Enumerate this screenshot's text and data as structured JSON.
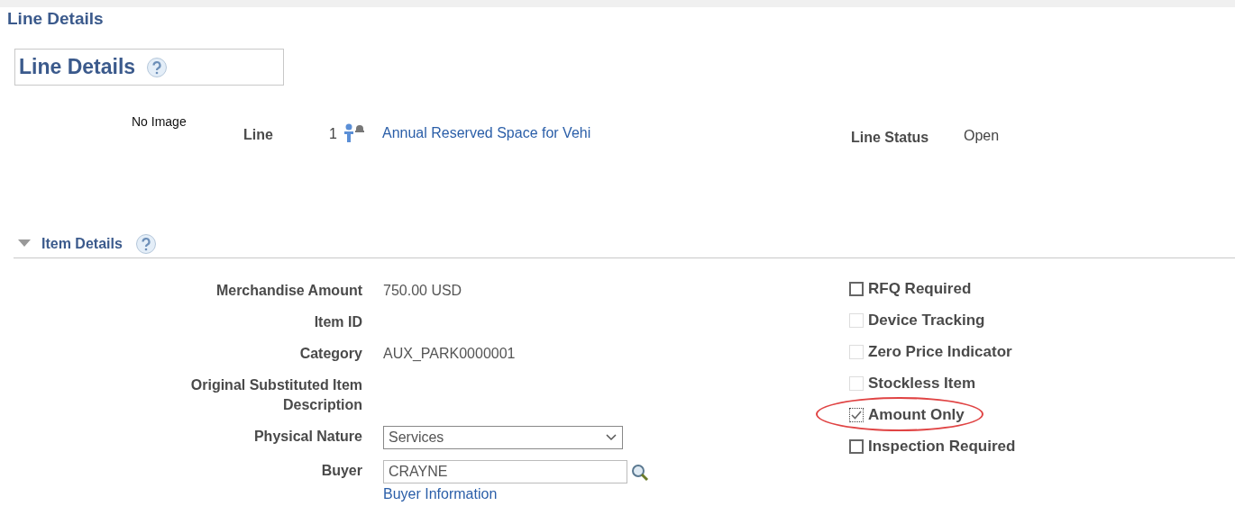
{
  "page_title": "Line Details",
  "panel": {
    "title": "Line Details"
  },
  "line": {
    "image_text": "No Image",
    "label": "Line",
    "number": "1",
    "description": "Annual Reserved Space for Vehi",
    "status_label": "Line Status",
    "status": "Open"
  },
  "section": {
    "title": "Item Details",
    "expanded": true
  },
  "fields": [
    {
      "kind": "text",
      "label": "Merchandise Amount",
      "value": "750.00 USD"
    },
    {
      "kind": "text",
      "label": "Item ID"
    },
    {
      "kind": "text",
      "label": "Category",
      "value": "AUX_PARK0000001"
    },
    {
      "kind": "text",
      "label": "Original Substituted Item Description"
    },
    {
      "kind": "select",
      "label": "Physical Nature",
      "value": "Services"
    },
    {
      "kind": "lookup",
      "label": "Buyer",
      "value": "CRAYNE",
      "link": "Buyer Information"
    }
  ],
  "checkboxes": [
    {
      "label": "RFQ Required",
      "checked": false,
      "disabled": false,
      "highlighted": false
    },
    {
      "label": "Device Tracking",
      "checked": false,
      "disabled": true,
      "highlighted": false
    },
    {
      "label": "Zero Price Indicator",
      "checked": false,
      "disabled": true,
      "highlighted": false
    },
    {
      "label": "Stockless Item",
      "checked": false,
      "disabled": true,
      "highlighted": false
    },
    {
      "label": "Amount Only",
      "checked": true,
      "disabled": false,
      "highlighted": true
    },
    {
      "label": "Inspection Required",
      "checked": false,
      "disabled": false,
      "highlighted": false
    }
  ]
}
